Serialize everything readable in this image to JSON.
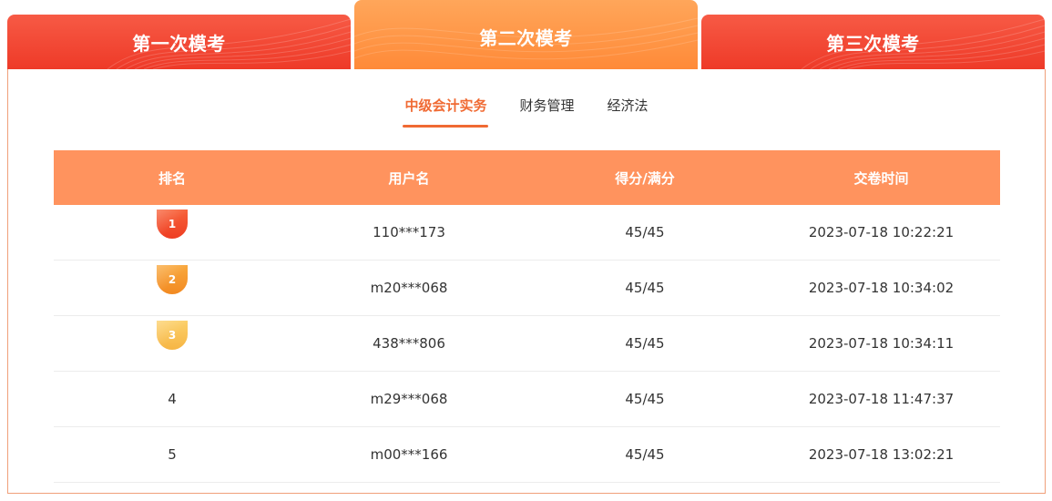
{
  "exam_tabs": [
    {
      "label": "第一次模考",
      "active": false
    },
    {
      "label": "第二次模考",
      "active": true
    },
    {
      "label": "第三次模考",
      "active": false
    }
  ],
  "subject_tabs": [
    {
      "label": "中级会计实务",
      "active": true
    },
    {
      "label": "财务管理",
      "active": false
    },
    {
      "label": "经济法",
      "active": false
    }
  ],
  "table": {
    "headers": [
      "排名",
      "用户名",
      "得分/满分",
      "交卷时间"
    ],
    "rows": [
      {
        "rank": "1",
        "user": "110***173",
        "score": "45/45",
        "time": "2023-07-18 10:22:21",
        "medal_color": "#f2502c"
      },
      {
        "rank": "2",
        "user": "m20***068",
        "score": "45/45",
        "time": "2023-07-18 10:34:02",
        "medal_color": "#f59a2e"
      },
      {
        "rank": "3",
        "user": "438***806",
        "score": "45/45",
        "time": "2023-07-18 10:34:11",
        "medal_color": "#f9c35a"
      },
      {
        "rank": "4",
        "user": "m29***068",
        "score": "45/45",
        "time": "2023-07-18 11:47:37"
      },
      {
        "rank": "5",
        "user": "m00***166",
        "score": "45/45",
        "time": "2023-07-18 13:02:21"
      }
    ]
  },
  "colors": {
    "tab_red": "#ee3a28",
    "tab_orange": "#ff8a38",
    "header_orange": "#ff935e",
    "active_text": "#f06a33"
  }
}
